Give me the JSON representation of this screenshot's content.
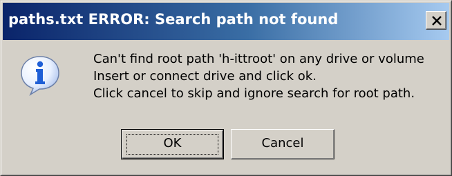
{
  "window": {
    "title": "paths.txt ERROR: Search path not found"
  },
  "message": {
    "lines": [
      "Can't find root path 'h-ittroot' on any drive or volume",
      "Insert or connect drive and click ok.",
      "Click cancel to skip and ignore search for root path."
    ]
  },
  "buttons": {
    "ok_label": "OK",
    "cancel_label": "Cancel"
  },
  "icons": {
    "info": "info-icon",
    "close": "close-icon"
  },
  "colors": {
    "titlebar_start": "#0a246a",
    "titlebar_end": "#a6caf0",
    "face": "#d4d0c8",
    "info_blue": "#1f5fd6"
  }
}
